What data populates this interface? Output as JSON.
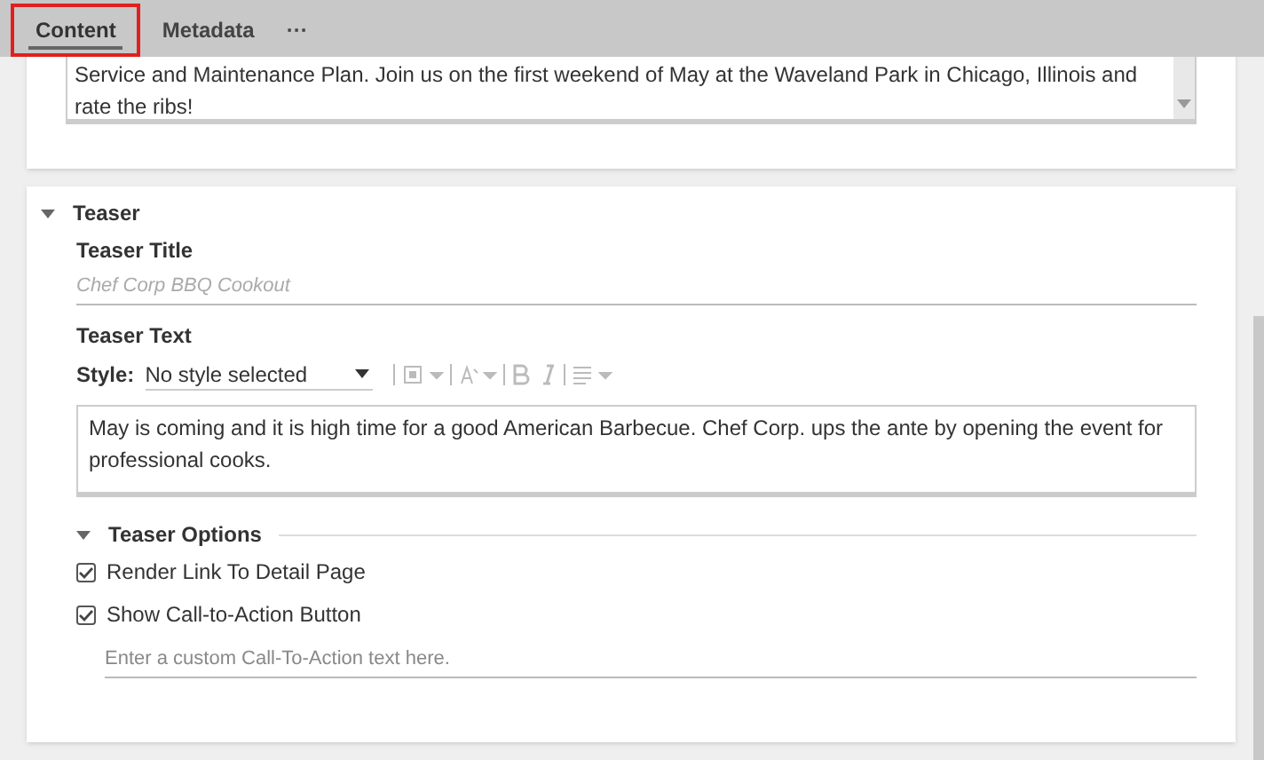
{
  "tabs": [
    {
      "label": "Content",
      "selected": true
    },
    {
      "label": "Metadata",
      "selected": false
    },
    {
      "label": "···",
      "selected": false
    }
  ],
  "body_text": {
    "value": "Service and Maintenance Plan. Join us on the first weekend of May at the Waveland Park in Chicago, Illinois and rate the ribs!"
  },
  "teaser": {
    "title": "Teaser",
    "expanded": true,
    "title_field": {
      "label": "Teaser Title",
      "placeholder": "Chef Corp BBQ Cookout"
    },
    "text_field": {
      "label": "Teaser Text",
      "style_label": "Style:",
      "style_value": "No style selected",
      "value": "May is coming and it is high time for a good American Barbecue. Chef Corp. ups the ante by opening the event for professional cooks."
    },
    "options": {
      "title": "Teaser Options",
      "expanded": true,
      "checkboxes": [
        {
          "label": "Render Link To Detail Page",
          "checked": true
        },
        {
          "label": "Show Call-to-Action Button",
          "checked": true
        }
      ],
      "cta_field": {
        "placeholder": "Enter a custom Call-To-Action text here."
      }
    }
  }
}
